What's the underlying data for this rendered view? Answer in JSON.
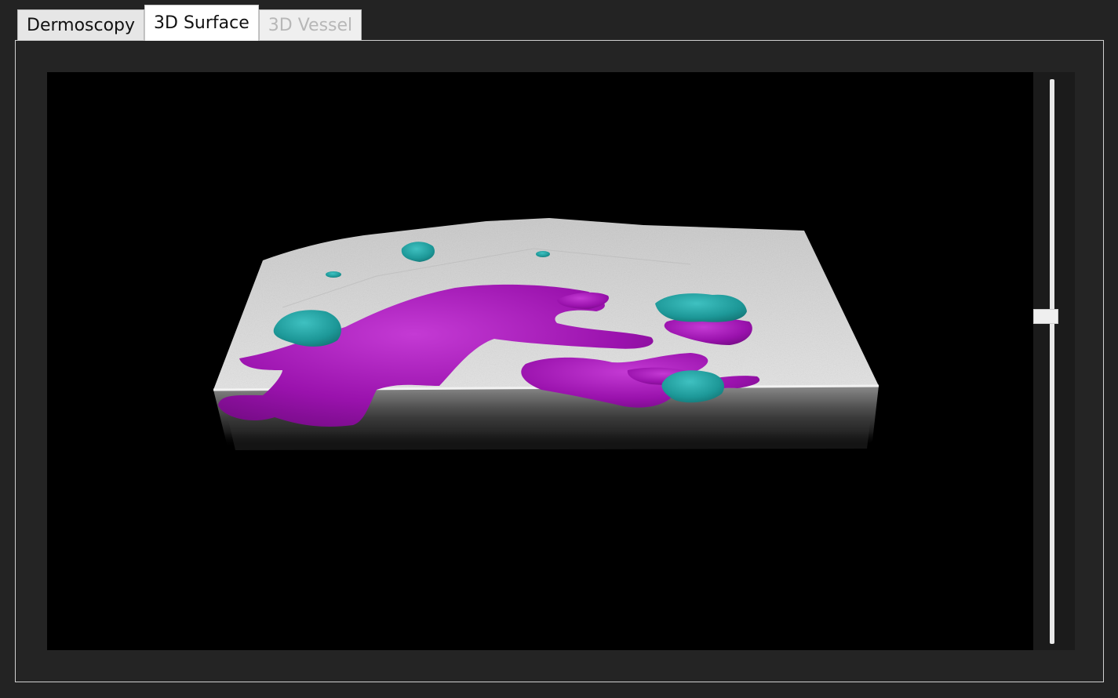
{
  "tabs": [
    {
      "label": "Dermoscopy",
      "state": "normal"
    },
    {
      "label": "3D Surface",
      "state": "active"
    },
    {
      "label": "3D Vessel",
      "state": "disabled"
    }
  ],
  "viewer": {
    "render_type": "3D volume rendering",
    "colors": {
      "background": "#000000",
      "tissue": "#d6d6d6",
      "magenta_segment": "#a010b4",
      "teal_segment": "#1f9c9c"
    }
  },
  "slider": {
    "orientation": "vertical",
    "value_fraction": 0.58
  }
}
